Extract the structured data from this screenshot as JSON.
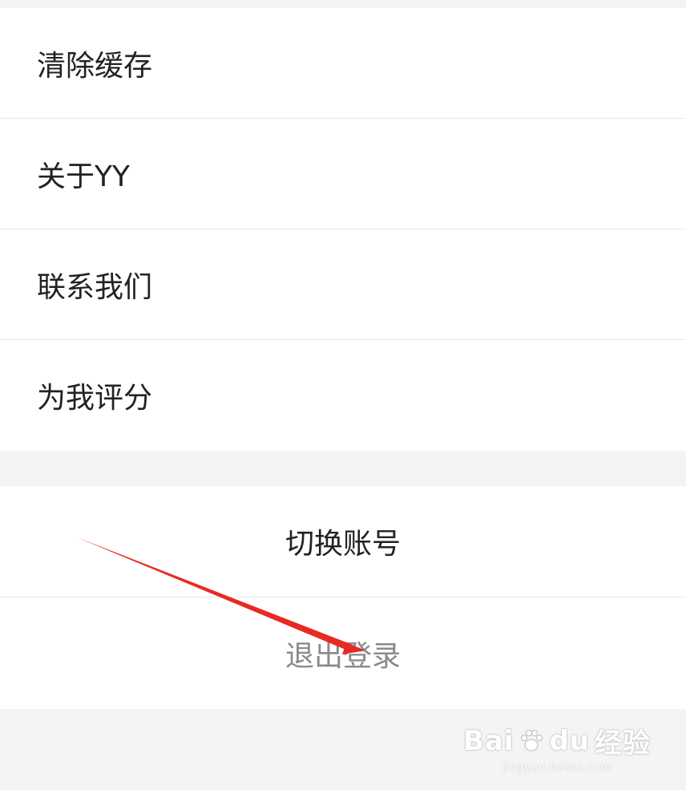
{
  "settings": {
    "items": [
      {
        "label": "清除缓存"
      },
      {
        "label": "关于YY"
      },
      {
        "label": "联系我们"
      },
      {
        "label": "为我评分"
      }
    ]
  },
  "account": {
    "switch_label": "切换账号",
    "logout_label": "退出登录"
  },
  "watermark": {
    "brand": "Bai",
    "brand_suffix": "du",
    "product": "经验",
    "url": "jingyan.baidu.com"
  },
  "colors": {
    "page_background": "#f4f4f4",
    "item_background": "#ffffff",
    "primary_text": "#222222",
    "logout_text": "#8a8a8a",
    "annotation_arrow": "#e82a24"
  }
}
